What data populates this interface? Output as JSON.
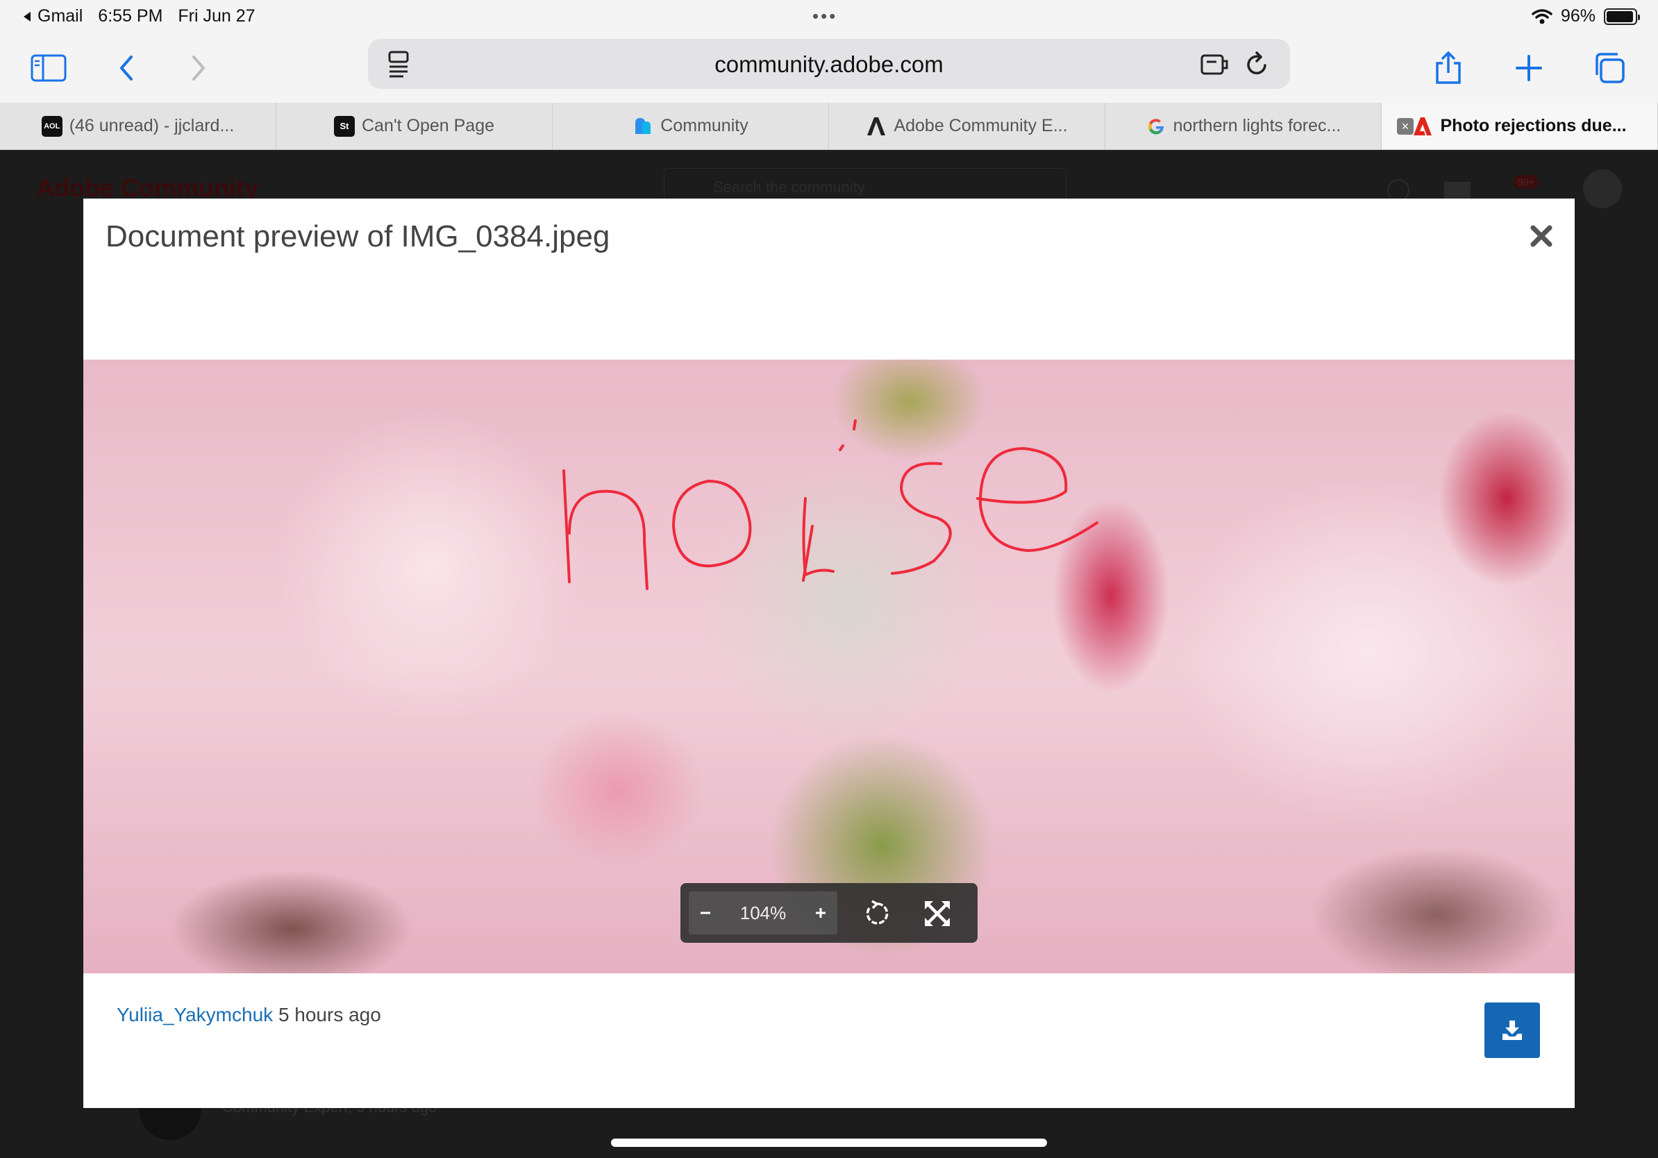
{
  "status_bar": {
    "back_app": "Gmail",
    "time": "6:55 PM",
    "date": "Fri Jun 27",
    "battery": "96%",
    "battery_level": 0.96
  },
  "browser": {
    "url": "community.adobe.com",
    "tabs": [
      {
        "label": "(46 unread) - jjclard...",
        "favicon": "AOL"
      },
      {
        "label": "Can't Open Page",
        "favicon": "St"
      },
      {
        "label": "Community",
        "favicon": "community-icon"
      },
      {
        "label": "Adobe Community E...",
        "favicon": "adobe-icon"
      },
      {
        "label": "northern lights forec...",
        "favicon": "google-icon"
      },
      {
        "label": "Photo rejections due...",
        "favicon": "adobe-red-icon"
      }
    ]
  },
  "background_page": {
    "logo": "Adobe Community",
    "search_placeholder": "Search the community",
    "notification_badge": "99+",
    "footer_text": "Community Expert, 5 hours ago"
  },
  "modal": {
    "title": "Document preview of IMG_0384.jpeg",
    "zoom_value": "104%",
    "author": "Yuliia_Yakymchuk",
    "time_ago": "5 hours ago"
  }
}
